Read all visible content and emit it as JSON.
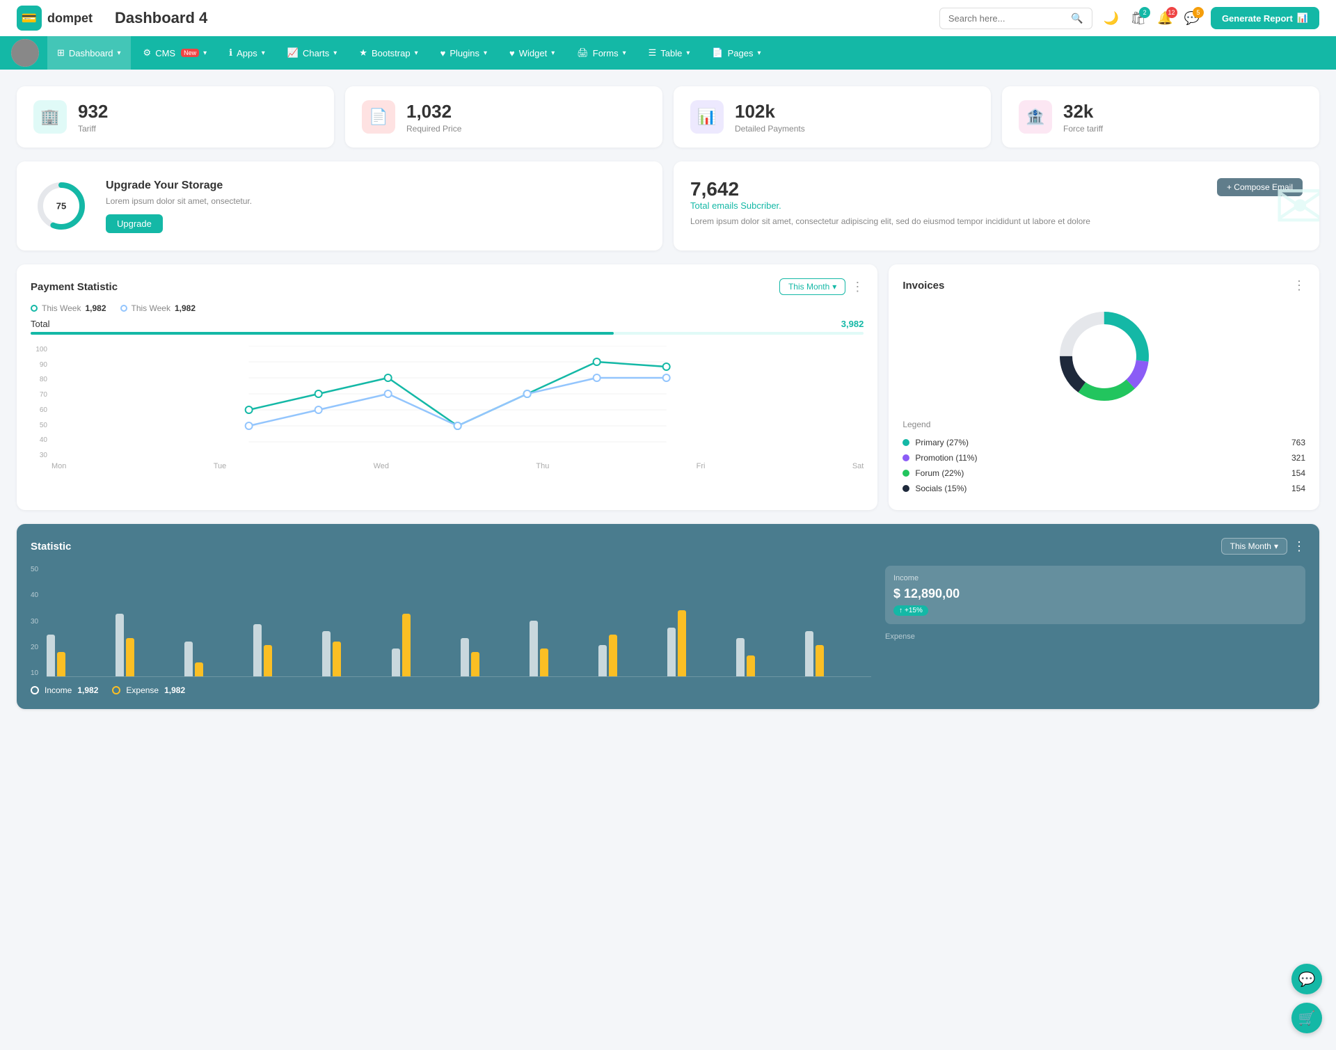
{
  "app": {
    "logo_text": "dompet",
    "page_title": "Dashboard 4",
    "search_placeholder": "Search here..."
  },
  "topbar": {
    "icons": {
      "cart_badge": "2",
      "bell_badge": "12",
      "chat_badge": "5"
    },
    "btn_report": "Generate Report"
  },
  "navbar": {
    "items": [
      {
        "id": "dashboard",
        "label": "Dashboard",
        "has_chevron": true,
        "active": true
      },
      {
        "id": "cms",
        "label": "CMS",
        "badge_new": true,
        "has_chevron": true
      },
      {
        "id": "apps",
        "label": "Apps",
        "has_chevron": true
      },
      {
        "id": "charts",
        "label": "Charts",
        "has_chevron": true
      },
      {
        "id": "bootstrap",
        "label": "Bootstrap",
        "has_chevron": true
      },
      {
        "id": "plugins",
        "label": "Plugins",
        "has_chevron": true
      },
      {
        "id": "widget",
        "label": "Widget",
        "has_chevron": true
      },
      {
        "id": "forms",
        "label": "Forms",
        "has_chevron": true
      },
      {
        "id": "table",
        "label": "Table",
        "has_chevron": true
      },
      {
        "id": "pages",
        "label": "Pages",
        "has_chevron": true
      }
    ]
  },
  "stat_cards": [
    {
      "id": "tariff",
      "value": "932",
      "label": "Tariff",
      "icon_type": "teal",
      "icon": "🏢"
    },
    {
      "id": "required_price",
      "value": "1,032",
      "label": "Required Price",
      "icon_type": "red",
      "icon": "📄"
    },
    {
      "id": "detailed_payments",
      "value": "102k",
      "label": "Detailed Payments",
      "icon_type": "purple",
      "icon": "📊"
    },
    {
      "id": "force_tariff",
      "value": "32k",
      "label": "Force tariff",
      "icon_type": "pink",
      "icon": "🏦"
    }
  ],
  "storage": {
    "percent": 75,
    "title": "Upgrade Your Storage",
    "desc": "Lorem ipsum dolor sit amet, onsectetur.",
    "btn_label": "Upgrade"
  },
  "email": {
    "count": "7,642",
    "sub_title": "Total emails Subcriber.",
    "desc": "Lorem ipsum dolor sit amet, consectetur adipiscing elit, sed do eiusmod tempor incididunt ut labore et dolore",
    "btn_label": "+ Compose Email"
  },
  "payment": {
    "title": "Payment Statistic",
    "period_btn": "This Month",
    "legend": [
      {
        "label": "This Week",
        "value": "1,982",
        "color": "#14b8a6"
      },
      {
        "label": "This Week",
        "value": "1,982",
        "color": "#93c5fd"
      }
    ],
    "total_label": "Total",
    "total_value": "3,982",
    "x_labels": [
      "Mon",
      "Tue",
      "Wed",
      "Thu",
      "Fri",
      "Sat"
    ],
    "y_labels": [
      "30",
      "40",
      "50",
      "60",
      "70",
      "80",
      "90",
      "100"
    ]
  },
  "invoices": {
    "title": "Invoices",
    "legend_title": "Legend",
    "items": [
      {
        "label": "Primary (27%)",
        "color": "#14b8a6",
        "value": "763"
      },
      {
        "label": "Promotion (11%)",
        "color": "#8b5cf6",
        "value": "321"
      },
      {
        "label": "Forum (22%)",
        "color": "#22c55e",
        "value": "154"
      },
      {
        "label": "Socials (15%)",
        "color": "#1e293b",
        "value": "154"
      }
    ]
  },
  "statistic": {
    "title": "Statistic",
    "period_btn": "This Month",
    "y_labels": [
      "10",
      "20",
      "30",
      "40",
      "50"
    ],
    "income": {
      "label": "Income",
      "value": "1,982",
      "dot_color": "#fff"
    },
    "expense": {
      "label": "Expense",
      "value": "1,982",
      "dot_color": "#fbbf24"
    },
    "income_panel": {
      "title": "Income",
      "value": "$ 12,890,00",
      "badge": "+15%"
    }
  },
  "month_selector": "Month"
}
